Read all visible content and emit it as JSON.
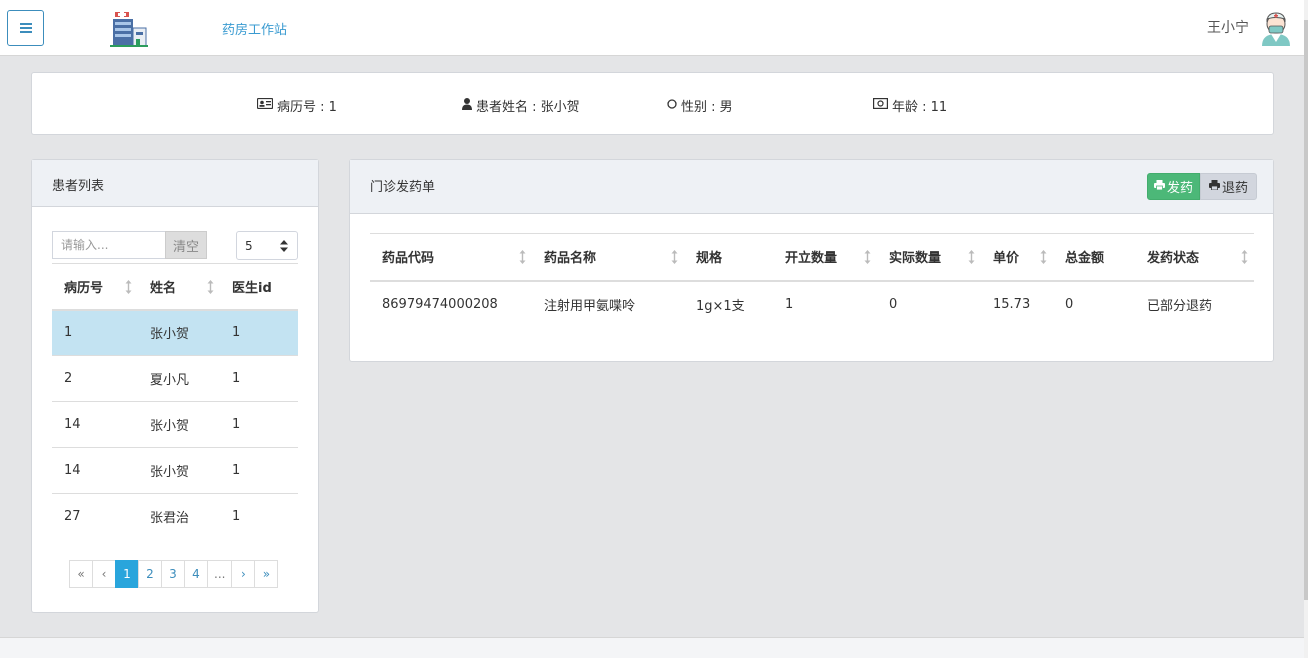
{
  "header": {
    "app_title": "药房工作站",
    "user_name": "王小宁",
    "menu_icon": "hamburger-icon",
    "logo_icon": "hospital-building-icon",
    "avatar_icon": "doctor-avatar-icon",
    "accent_color": "#3c8dbc"
  },
  "patient_info": {
    "record_label": "病历号 : 1",
    "name_label": "患者姓名 : 张小贺",
    "gender_label": "性别 : 男",
    "age_label": "年龄 : 11"
  },
  "patient_list": {
    "title": "患者列表",
    "search_placeholder": "请输入...",
    "clear_label": "清空",
    "page_size": "5",
    "columns": [
      "病历号",
      "姓名",
      "医生id"
    ],
    "rows": [
      {
        "record": "1",
        "name": "张小贺",
        "doctor_id": "1"
      },
      {
        "record": "2",
        "name": "夏小凡",
        "doctor_id": "1"
      },
      {
        "record": "14",
        "name": "张小贺",
        "doctor_id": "1"
      },
      {
        "record": "14",
        "name": "张小贺",
        "doctor_id": "1"
      },
      {
        "record": "27",
        "name": "张君治",
        "doctor_id": "1"
      }
    ],
    "pagination": [
      "«",
      "‹",
      "1",
      "2",
      "3",
      "4",
      "...",
      "›",
      "»"
    ],
    "active_page": "1"
  },
  "dispense": {
    "title": "门诊发药单",
    "dispense_label": "发药",
    "return_label": "退药",
    "dispense_color": "#4cb878",
    "columns": [
      "药品代码",
      "药品名称",
      "规格",
      "开立数量",
      "实际数量",
      "单价",
      "总金额",
      "发药状态"
    ],
    "rows": [
      {
        "code": "86979474000208",
        "name": "注射用甲氨喋呤",
        "spec": "1g×1支",
        "ordered": "1",
        "actual": "0",
        "price": "15.73",
        "total": "0",
        "status": "已部分退药"
      }
    ]
  }
}
